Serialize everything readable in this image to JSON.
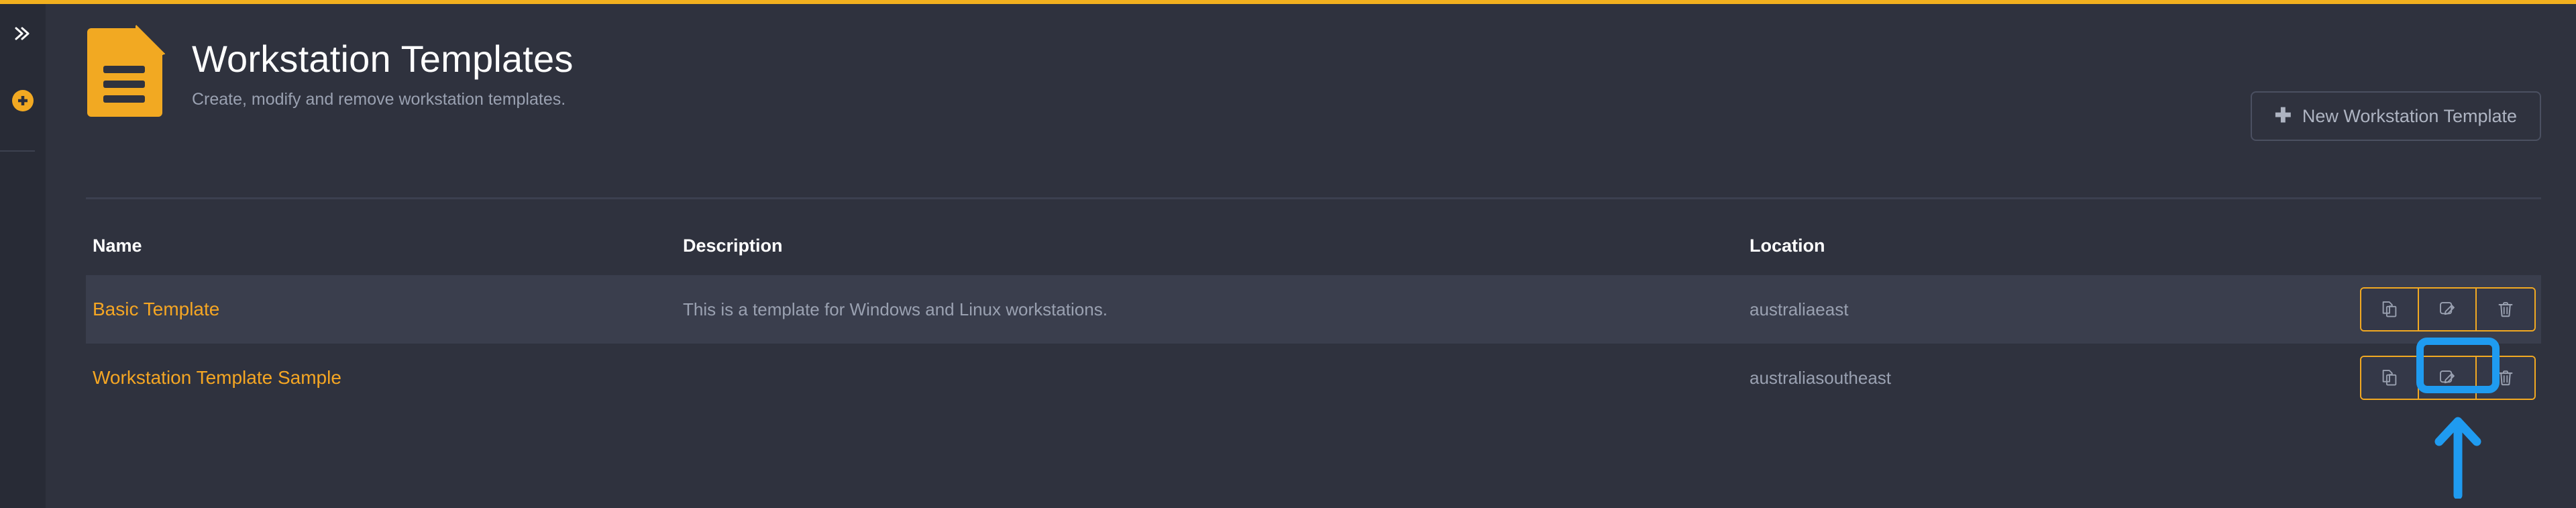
{
  "accent_colors": {
    "top_bar": "#f2b01e",
    "brand_amber": "#f2a922",
    "link_amber": "#f5a623",
    "annotation_blue": "#1f9bf0",
    "page_background": "#2f323e",
    "rail_background": "#282b36",
    "row_hover": "#3a3e4d"
  },
  "rail": {
    "expand_icon": "chevron-double-right-icon",
    "add_icon": "plus-circle-icon"
  },
  "header": {
    "icon": "document-lines-icon",
    "title": "Workstation Templates",
    "subtitle": "Create, modify and remove workstation templates.",
    "new_button": {
      "icon": "plus-icon",
      "plus": "✚",
      "label": "New Workstation Template"
    }
  },
  "table": {
    "columns": [
      {
        "key": "name",
        "label": "Name"
      },
      {
        "key": "description",
        "label": "Description"
      },
      {
        "key": "location",
        "label": "Location"
      }
    ],
    "actions": [
      {
        "name": "copy-button",
        "icon": "copy-icon",
        "title": "Copy"
      },
      {
        "name": "edit-button",
        "icon": "edit-pencil-icon",
        "title": "Edit"
      },
      {
        "name": "delete-button",
        "icon": "trash-icon",
        "title": "Delete"
      }
    ],
    "rows": [
      {
        "name": "Basic Template",
        "description": "This is a template for Windows and Linux workstations.",
        "location": "australiaeast",
        "hovered": true
      },
      {
        "name": "Workstation Template Sample",
        "description": "",
        "location": "australiasoutheast",
        "hovered": false
      }
    ]
  },
  "annotation": {
    "target": "delete-button-row-2",
    "shape": "rounded-rectangle-highlight",
    "pointer": "up-arrow",
    "color": "#1f9bf0"
  }
}
